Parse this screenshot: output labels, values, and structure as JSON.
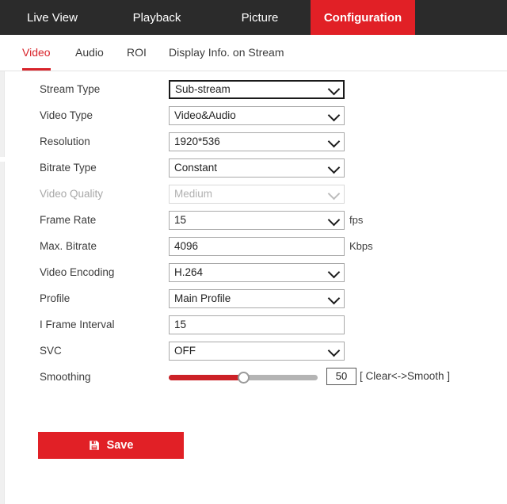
{
  "topnav": {
    "items": [
      {
        "label": "Live View",
        "active": false
      },
      {
        "label": "Playback",
        "active": false
      },
      {
        "label": "Picture",
        "active": false
      },
      {
        "label": "Configuration",
        "active": true
      }
    ]
  },
  "subtabs": {
    "items": [
      {
        "label": "Video",
        "active": true
      },
      {
        "label": "Audio",
        "active": false
      },
      {
        "label": "ROI",
        "active": false
      },
      {
        "label": "Display Info. on Stream",
        "active": false
      }
    ]
  },
  "form": {
    "stream_type": {
      "label": "Stream Type",
      "value": "Sub-stream"
    },
    "video_type": {
      "label": "Video Type",
      "value": "Video&Audio"
    },
    "resolution": {
      "label": "Resolution",
      "value": "1920*536"
    },
    "bitrate_type": {
      "label": "Bitrate Type",
      "value": "Constant"
    },
    "video_quality": {
      "label": "Video Quality",
      "value": "Medium"
    },
    "frame_rate": {
      "label": "Frame Rate",
      "value": "15",
      "unit": "fps"
    },
    "max_bitrate": {
      "label": "Max. Bitrate",
      "value": "4096",
      "unit": "Kbps"
    },
    "video_encoding": {
      "label": "Video Encoding",
      "value": "H.264"
    },
    "profile": {
      "label": "Profile",
      "value": "Main Profile"
    },
    "i_frame_interval": {
      "label": "I Frame Interval",
      "value": "15"
    },
    "svc": {
      "label": "SVC",
      "value": "OFF"
    },
    "smoothing": {
      "label": "Smoothing",
      "value": "50",
      "hint": "[ Clear<->Smooth ]"
    }
  },
  "actions": {
    "save_label": "Save",
    "save_icon": "floppy-disk-icon"
  },
  "colors": {
    "brand_red": "#e12026",
    "nav_dark": "#2b2b2b",
    "slider_fill": "#cc2127",
    "accent_underline": "#d8232a"
  }
}
